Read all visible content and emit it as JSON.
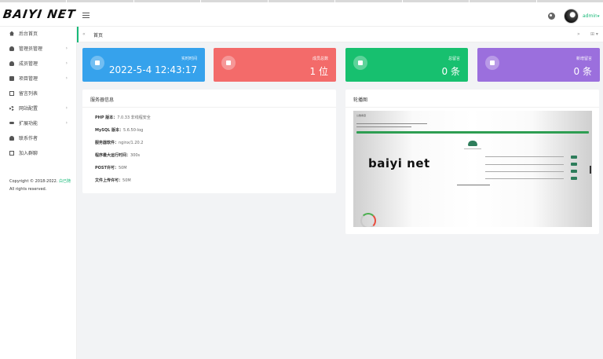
{
  "header": {
    "logo": "BAIYI NET",
    "user_name": "admin",
    "icons": {
      "menu": "menu-toggle-icon",
      "skin": "palette-icon",
      "caret": "chevron-down-icon"
    }
  },
  "sidebar": {
    "items": [
      {
        "label": "后台首页",
        "icon": "home-icon",
        "has_arrow": false
      },
      {
        "label": "管理员管理",
        "icon": "user-icon",
        "has_arrow": true
      },
      {
        "label": "成员管理",
        "icon": "user-icon",
        "has_arrow": true
      },
      {
        "label": "项目管理",
        "icon": "document-icon",
        "has_arrow": true
      },
      {
        "label": "留言列表",
        "icon": "message-icon",
        "has_arrow": false
      },
      {
        "label": "网站配置",
        "icon": "gear-icon",
        "has_arrow": true
      },
      {
        "label": "扩展功能",
        "icon": "link-icon",
        "has_arrow": true
      },
      {
        "label": "联系作者",
        "icon": "bell-icon",
        "has_arrow": false
      },
      {
        "label": "加入群聊",
        "icon": "chat-icon",
        "has_arrow": false
      }
    ],
    "copyright": {
      "prefix": "Copyright © 2018-2022.",
      "link": "白已随",
      "suffix": "All rights reserved."
    }
  },
  "tabs": {
    "left_arrow": "«",
    "home": "首页",
    "right_arrow": "»",
    "dropdown": "⊞ ▾"
  },
  "stats": [
    {
      "label": "实时时间",
      "value": "2022-5-4 12:43:17",
      "color": "#36a2ec",
      "icon": "rocket-icon"
    },
    {
      "label": "成员总数",
      "value": "1 位",
      "color": "#f36b6a",
      "icon": "user-icon"
    },
    {
      "label": "总留言",
      "value": "0 条",
      "color": "#17c06f",
      "icon": "rocket-icon"
    },
    {
      "label": "新增留言",
      "value": "0 条",
      "color": "#9b6fdd",
      "icon": "message-icon"
    }
  ],
  "server": {
    "title": "服务器信息",
    "rows": [
      {
        "key": "PHP 版本：",
        "value": "7.0.33 非线程安全"
      },
      {
        "key": "MySQL 版本：",
        "value": "5.6.50-log"
      },
      {
        "key": "服务器软件：",
        "value": "nginx/1.20.2"
      },
      {
        "key": "程序最大运行时间：",
        "value": "300s"
      },
      {
        "key": "POST许可：",
        "value": "50M"
      },
      {
        "key": "文件上传许可：",
        "value": "50M"
      }
    ]
  },
  "carousel": {
    "title": "轮播图",
    "image_title": "公告条目",
    "image_logo": "baiyi net"
  }
}
